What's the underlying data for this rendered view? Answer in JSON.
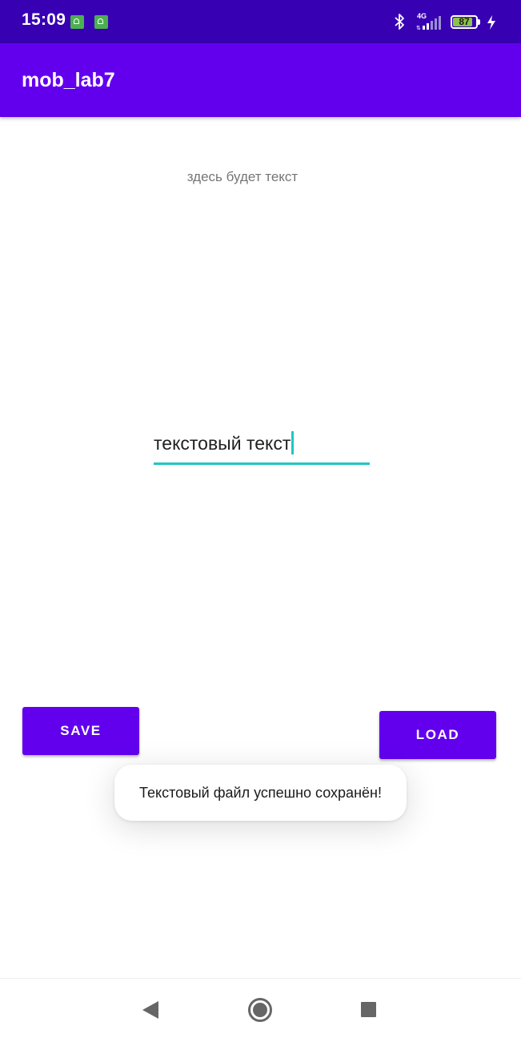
{
  "status_bar": {
    "time": "15:09",
    "network": "4G",
    "battery_level": "87",
    "battery_fraction": 0.87,
    "icons": [
      "android-notification-icon",
      "android-notification-icon",
      "bluetooth-icon",
      "signal-icon",
      "battery-icon",
      "charging-bolt-icon"
    ],
    "background_color": "#3700b3"
  },
  "app_bar": {
    "title": "mob_lab7",
    "background_color": "#6200ee"
  },
  "main": {
    "hint_text": "здесь будет текст",
    "input_value": "текстовый текст",
    "accent_color": "#1ec7c4"
  },
  "buttons": {
    "save_label": "SAVE",
    "load_label": "LOAD",
    "color": "#6200ee"
  },
  "toast": {
    "message": "Текстовый файл успешно сохранён!"
  },
  "nav_bar": {
    "icons": [
      "back-icon",
      "home-icon",
      "recents-icon"
    ]
  }
}
